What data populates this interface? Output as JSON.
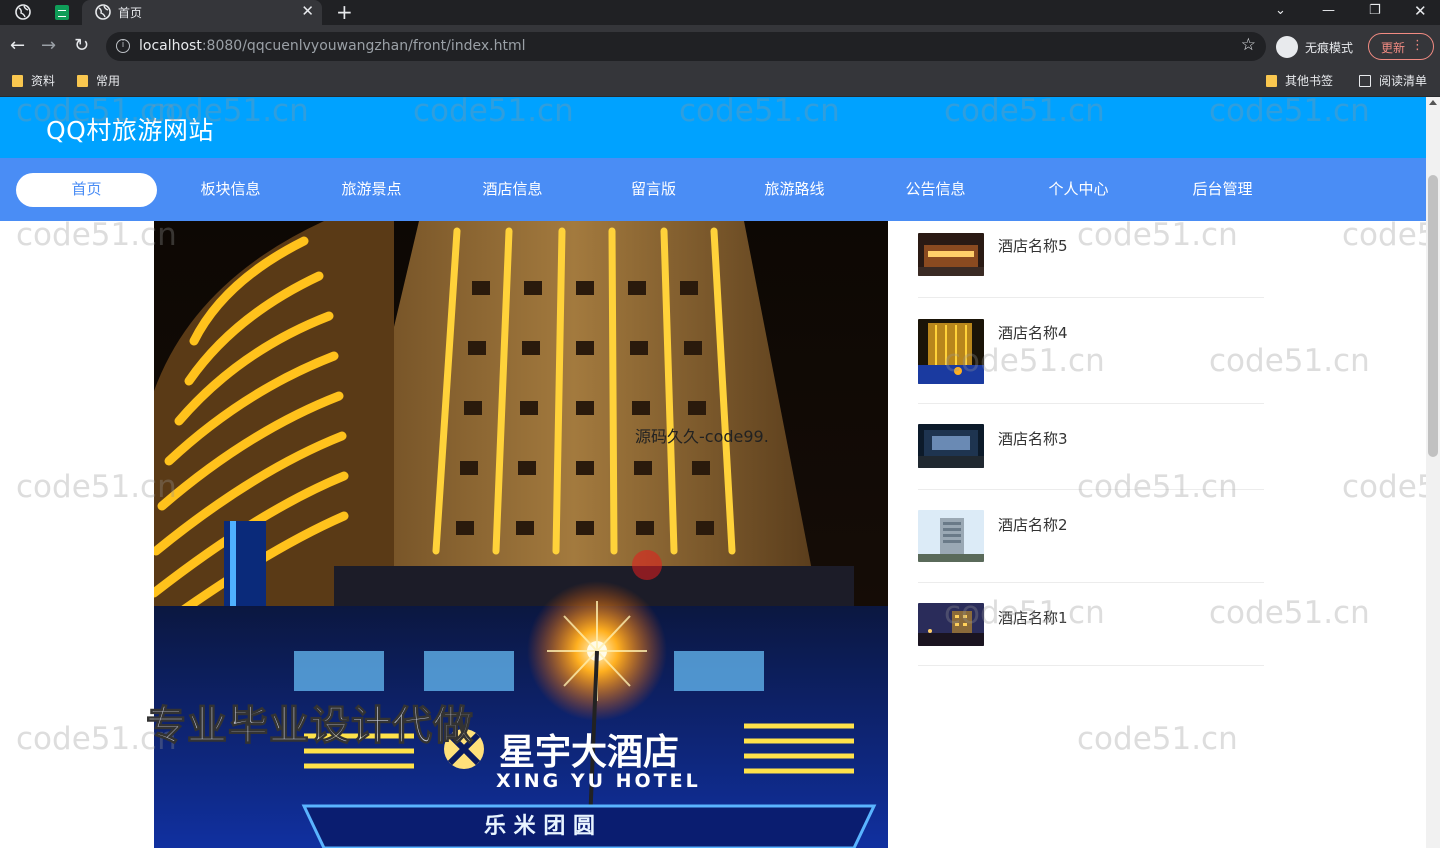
{
  "browser": {
    "tab_title": "首页",
    "url_host": "localhost",
    "url_rest": ":8080/qqcuenlvyouwangzhan/front/index.html",
    "incognito_label": "无痕模式",
    "update_label": "更新",
    "bookmarks": [
      "资料",
      "常用"
    ],
    "bookmarks_right": [
      "其他书签",
      "阅读清单"
    ]
  },
  "site": {
    "title": "QQ村旅游网站",
    "nav": [
      {
        "label": "首页",
        "active": true
      },
      {
        "label": "板块信息"
      },
      {
        "label": "旅游景点"
      },
      {
        "label": "酒店信息"
      },
      {
        "label": "留言版"
      },
      {
        "label": "旅游路线"
      },
      {
        "label": "公告信息"
      },
      {
        "label": "个人中心"
      },
      {
        "label": "后台管理"
      }
    ]
  },
  "banner": {
    "signage_cn": "星宇大酒店",
    "signage_en": "XING YU HOTEL",
    "shop_cn": "乐 米 团 圆"
  },
  "hotels": [
    {
      "name": "酒店名称5"
    },
    {
      "name": "酒店名称4"
    },
    {
      "name": "酒店名称3"
    },
    {
      "name": "酒店名称2"
    },
    {
      "name": "酒店名称1"
    }
  ],
  "overlays": {
    "watermark": "code51.cn",
    "center_text": "源码久久-code99.",
    "caption": "专业毕业设计代做"
  },
  "colors": {
    "header": "#00a2ff",
    "nav": "#4a8df5",
    "browser_dark": "#202124"
  }
}
